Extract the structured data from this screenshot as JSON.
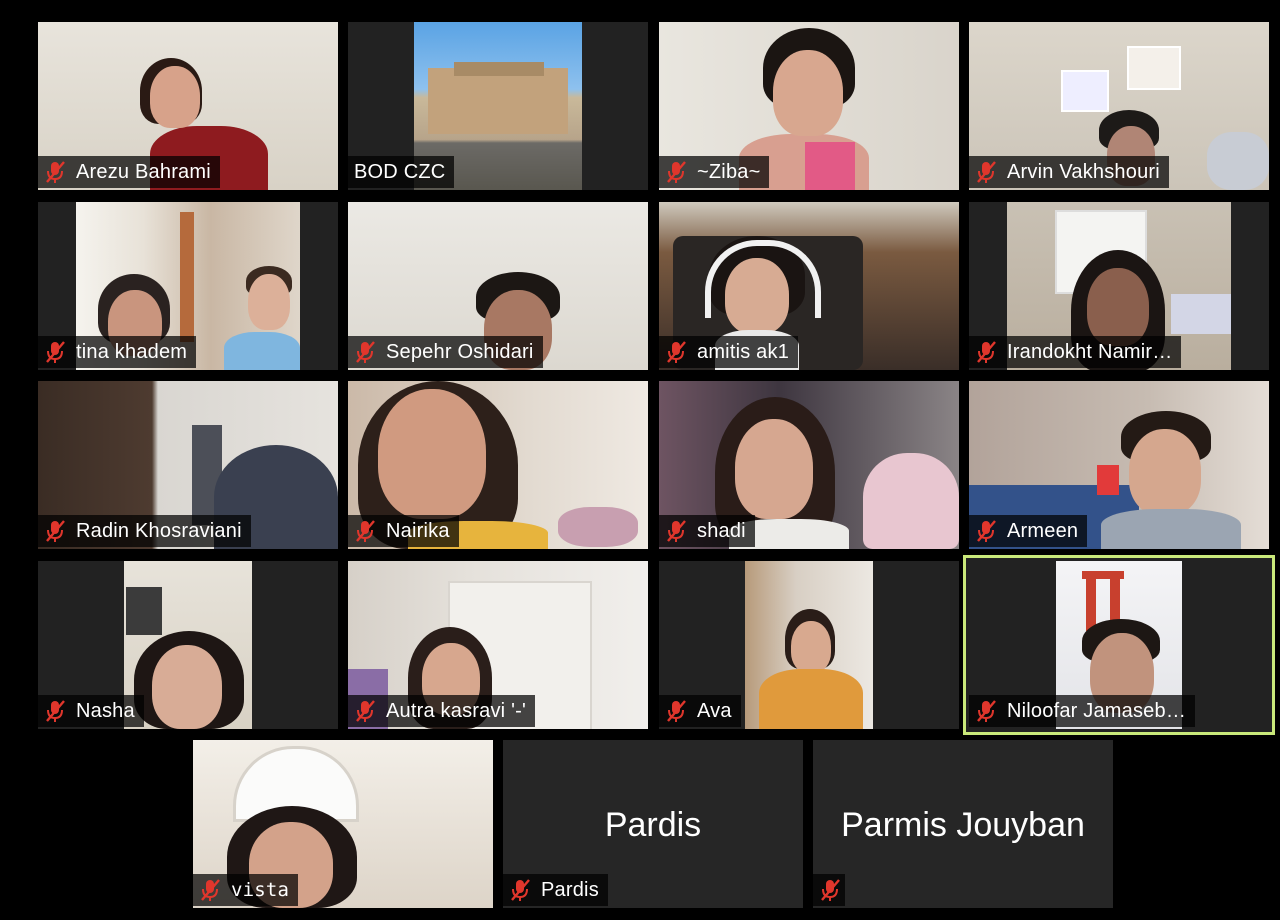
{
  "participants": [
    {
      "name": "Arezu Bahrami",
      "muted": true
    },
    {
      "name": "BOD CZC",
      "muted": false
    },
    {
      "name": "~Ziba~",
      "muted": true
    },
    {
      "name": "Arvin Vakhshouri",
      "muted": true
    },
    {
      "name": "tina khadem",
      "muted": true
    },
    {
      "name": "Sepehr Oshidari",
      "muted": true
    },
    {
      "name": "amitis ak1",
      "muted": true
    },
    {
      "name": "Irandokht Namir…",
      "muted": true
    },
    {
      "name": "Radin Khosraviani",
      "muted": true
    },
    {
      "name": "Nairika",
      "muted": true
    },
    {
      "name": "shadi",
      "muted": true
    },
    {
      "name": "Armeen",
      "muted": true
    },
    {
      "name": "Nasha",
      "muted": true
    },
    {
      "name": "Autra kasravi '-'",
      "muted": true
    },
    {
      "name": "Ava",
      "muted": true
    },
    {
      "name": "Niloofar Jamaseb…",
      "muted": true,
      "active_speaker": true
    },
    {
      "name": "vista",
      "muted": true
    },
    {
      "name": "Pardis",
      "muted": true,
      "video_off": true,
      "display_name": "Pardis"
    },
    {
      "name": "",
      "muted": true,
      "video_off": true,
      "display_name": "Parmis Jouyban"
    }
  ],
  "colors": {
    "background": "#000000",
    "tile_background": "#222222",
    "active_speaker_border": "#c9e87a",
    "muted_icon": "#e0362c"
  },
  "icons": {
    "muted": "microphone-muted-icon"
  }
}
